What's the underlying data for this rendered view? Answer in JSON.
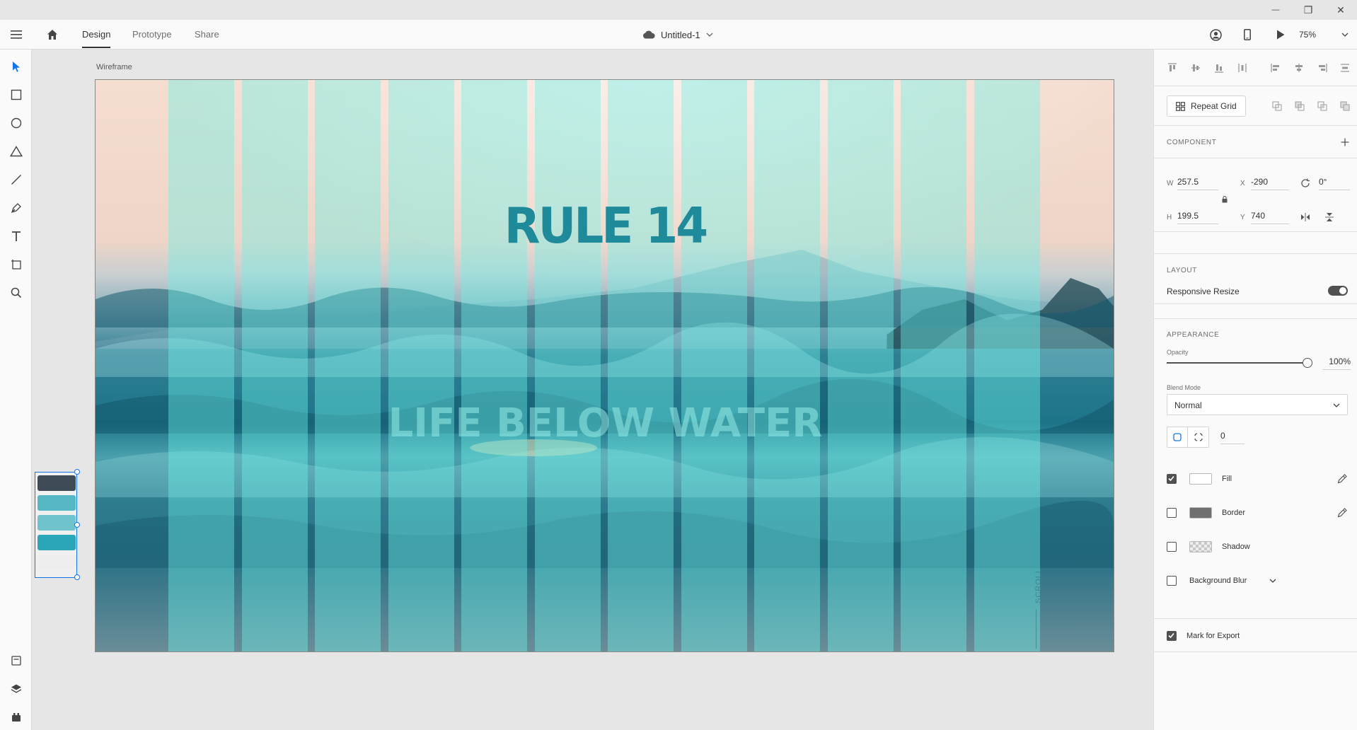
{
  "window": {
    "minimize_glyph": "—",
    "restore_glyph": "❐",
    "close_glyph": "✕"
  },
  "appbar": {
    "tabs": [
      {
        "label": "Design"
      },
      {
        "label": "Prototype"
      },
      {
        "label": "Share"
      }
    ],
    "document_title": "Untitled-1",
    "zoom": "75%"
  },
  "canvas": {
    "artboard_label": "Wireframe",
    "hero_title": "RULE 14",
    "headline": "LIFE BELOW WATER",
    "scroll_label": "SCROLL",
    "component_colors": [
      "#3f4b57",
      "#56b7c4",
      "#6fc3cc",
      "#2aa6b8",
      "#eeeeee"
    ]
  },
  "panel": {
    "repeat_grid": "Repeat Grid",
    "component_heading": "COMPONENT",
    "w_label": "W",
    "w_value": "257.5",
    "h_label": "H",
    "h_value": "199.5",
    "x_label": "X",
    "x_value": "-290",
    "y_label": "Y",
    "y_value": "740",
    "rotation_value": "0°",
    "layout_heading": "LAYOUT",
    "responsive_resize": "Responsive Resize",
    "appearance_heading": "APPEARANCE",
    "opacity_label": "Opacity",
    "opacity_value": "100%",
    "blend_mode_label": "Blend Mode",
    "blend_mode_value": "Normal",
    "corner_radius_value": "0",
    "fill_label": "Fill",
    "fill_checked": true,
    "fill_color": "#ffffff",
    "border_label": "Border",
    "border_checked": false,
    "border_color": "#707070",
    "shadow_label": "Shadow",
    "shadow_checked": false,
    "background_blur_label": "Background Blur",
    "background_blur_checked": false,
    "mark_for_export": "Mark for Export",
    "mark_for_export_checked": true
  }
}
